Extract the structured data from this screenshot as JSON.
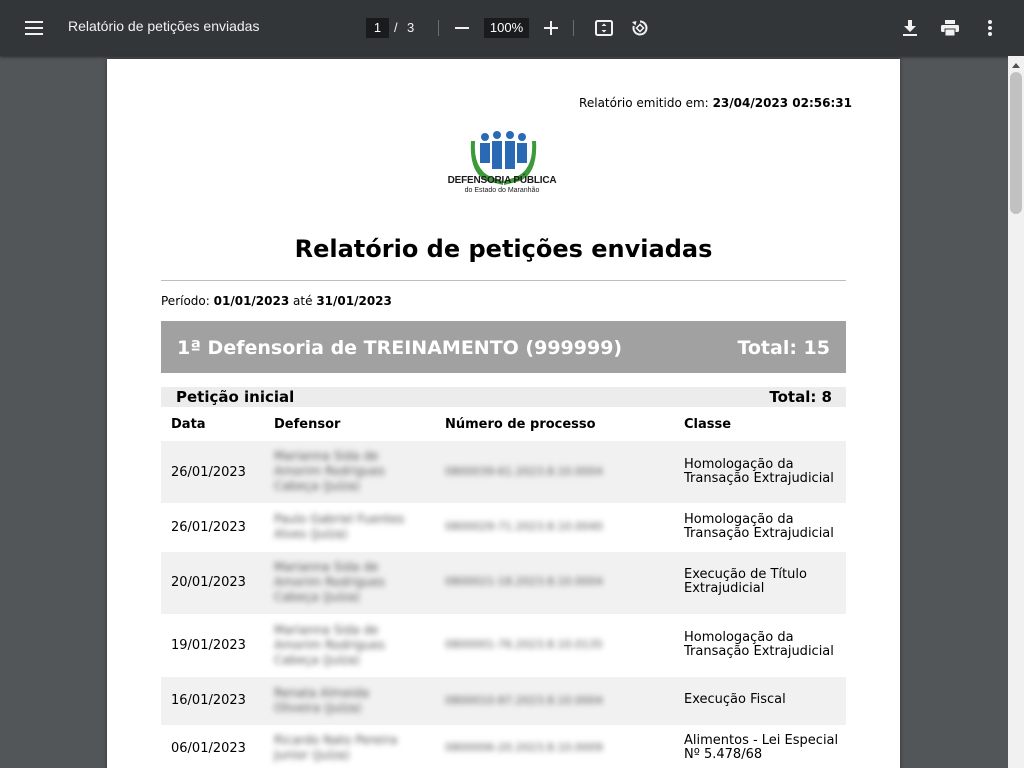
{
  "toolbar": {
    "title": "Relatório de petições enviadas",
    "page_current": "1",
    "page_separator": "/",
    "page_total": "3",
    "zoom": "100%"
  },
  "icons": {
    "menu": "hamburger-menu-icon",
    "zoom_out": "minus-icon",
    "zoom_in": "plus-icon",
    "fit": "fit-to-page-icon",
    "rotate": "rotate-icon",
    "download": "download-icon",
    "print": "print-icon",
    "more": "more-vertical-icon"
  },
  "report": {
    "emitted_label": "Relatório emitido em:",
    "emitted_value": "23/04/2023 02:56:31",
    "logo_name": "DEFENSORIA PÚBLICA",
    "logo_sub": "do Estado do Maranhão",
    "title": "Relatório de petições enviadas",
    "period_label": "Período:",
    "period_start": "01/01/2023",
    "period_until": "até",
    "period_end": "31/01/2023",
    "unit_name": "1ª Defensoria de TREINAMENTO (999999)",
    "unit_total": "Total: 15",
    "type_name": "Petição inicial",
    "type_total": "Total: 8",
    "columns": [
      "Data",
      "Defensor",
      "Número de processo",
      "Classe"
    ],
    "rows": [
      {
        "date": "26/01/2023",
        "defensor": "Marianna Sida de Amorim Rodrigues Cabeça (Juíza)",
        "processo": "0800039-61.2023.8.10.0004",
        "classe": "Homologação da Transação Extrajudicial"
      },
      {
        "date": "26/01/2023",
        "defensor": "Paulo Gabriel Fuentes Alves (Juíza)",
        "processo": "0800029-71.2023.8.10.0040",
        "classe": "Homologação da Transação Extrajudicial"
      },
      {
        "date": "20/01/2023",
        "defensor": "Marianna Sida de Amorim Rodrigues Cabeça (Juíza)",
        "processo": "0800021-18.2023.8.10.0004",
        "classe": "Execução de Título Extrajudicial"
      },
      {
        "date": "19/01/2023",
        "defensor": "Marianna Sida de Amorim Rodrigues Cabeça (Juíza)",
        "processo": "0800001-76.2023.8.10.0135",
        "classe": "Homologação da Transação Extrajudicial"
      },
      {
        "date": "16/01/2023",
        "defensor": "Renata Almeida Oliveira (Juíza)",
        "processo": "0800010-87.2023.8.10.0004",
        "classe": "Execução Fiscal"
      },
      {
        "date": "06/01/2023",
        "defensor": "Ricardo Nato Pereira Junior (Juíza)",
        "processo": "0800006-20.2023.8.10.0009",
        "classe": "Alimentos - Lei Especial Nº 5.478/68"
      }
    ]
  },
  "colors": {
    "toolbar_bg": "#323639",
    "viewer_bg": "#525659",
    "unit_bar": "#a1a1a1",
    "type_bar": "#ececec",
    "row_alt": "#f1f1f1",
    "logo_blue": "#2a6ab5",
    "logo_green": "#3d9a3a"
  }
}
